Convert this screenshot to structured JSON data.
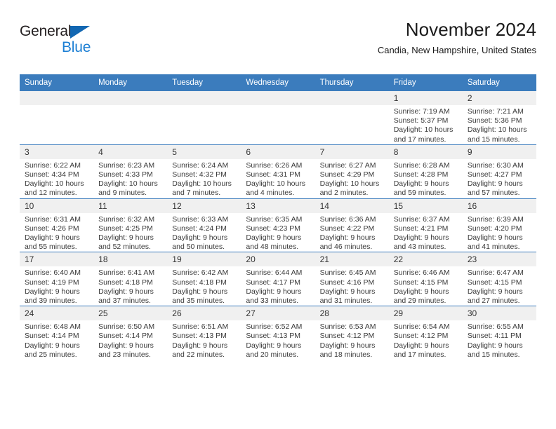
{
  "brand": {
    "name_part1": "General",
    "name_part2": "Blue",
    "triangle_color": "#1267b2",
    "blue_color": "#1c7fd4"
  },
  "header": {
    "month_title": "November 2024",
    "location": "Candia, New Hampshire, United States"
  },
  "theme": {
    "header_blue": "#3b7cbd",
    "daynum_band": "#f0f0f0"
  },
  "calendar": {
    "weekday_headers": [
      "Sunday",
      "Monday",
      "Tuesday",
      "Wednesday",
      "Thursday",
      "Friday",
      "Saturday"
    ],
    "weeks": [
      [
        {
          "day": "",
          "empty": true
        },
        {
          "day": "",
          "empty": true
        },
        {
          "day": "",
          "empty": true
        },
        {
          "day": "",
          "empty": true
        },
        {
          "day": "",
          "empty": true
        },
        {
          "day": "1",
          "sunrise": "Sunrise: 7:19 AM",
          "sunset": "Sunset: 5:37 PM",
          "daylight": "Daylight: 10 hours and 17 minutes."
        },
        {
          "day": "2",
          "sunrise": "Sunrise: 7:21 AM",
          "sunset": "Sunset: 5:36 PM",
          "daylight": "Daylight: 10 hours and 15 minutes."
        }
      ],
      [
        {
          "day": "3",
          "sunrise": "Sunrise: 6:22 AM",
          "sunset": "Sunset: 4:34 PM",
          "daylight": "Daylight: 10 hours and 12 minutes."
        },
        {
          "day": "4",
          "sunrise": "Sunrise: 6:23 AM",
          "sunset": "Sunset: 4:33 PM",
          "daylight": "Daylight: 10 hours and 9 minutes."
        },
        {
          "day": "5",
          "sunrise": "Sunrise: 6:24 AM",
          "sunset": "Sunset: 4:32 PM",
          "daylight": "Daylight: 10 hours and 7 minutes."
        },
        {
          "day": "6",
          "sunrise": "Sunrise: 6:26 AM",
          "sunset": "Sunset: 4:31 PM",
          "daylight": "Daylight: 10 hours and 4 minutes."
        },
        {
          "day": "7",
          "sunrise": "Sunrise: 6:27 AM",
          "sunset": "Sunset: 4:29 PM",
          "daylight": "Daylight: 10 hours and 2 minutes."
        },
        {
          "day": "8",
          "sunrise": "Sunrise: 6:28 AM",
          "sunset": "Sunset: 4:28 PM",
          "daylight": "Daylight: 9 hours and 59 minutes."
        },
        {
          "day": "9",
          "sunrise": "Sunrise: 6:30 AM",
          "sunset": "Sunset: 4:27 PM",
          "daylight": "Daylight: 9 hours and 57 minutes."
        }
      ],
      [
        {
          "day": "10",
          "sunrise": "Sunrise: 6:31 AM",
          "sunset": "Sunset: 4:26 PM",
          "daylight": "Daylight: 9 hours and 55 minutes."
        },
        {
          "day": "11",
          "sunrise": "Sunrise: 6:32 AM",
          "sunset": "Sunset: 4:25 PM",
          "daylight": "Daylight: 9 hours and 52 minutes."
        },
        {
          "day": "12",
          "sunrise": "Sunrise: 6:33 AM",
          "sunset": "Sunset: 4:24 PM",
          "daylight": "Daylight: 9 hours and 50 minutes."
        },
        {
          "day": "13",
          "sunrise": "Sunrise: 6:35 AM",
          "sunset": "Sunset: 4:23 PM",
          "daylight": "Daylight: 9 hours and 48 minutes."
        },
        {
          "day": "14",
          "sunrise": "Sunrise: 6:36 AM",
          "sunset": "Sunset: 4:22 PM",
          "daylight": "Daylight: 9 hours and 46 minutes."
        },
        {
          "day": "15",
          "sunrise": "Sunrise: 6:37 AM",
          "sunset": "Sunset: 4:21 PM",
          "daylight": "Daylight: 9 hours and 43 minutes."
        },
        {
          "day": "16",
          "sunrise": "Sunrise: 6:39 AM",
          "sunset": "Sunset: 4:20 PM",
          "daylight": "Daylight: 9 hours and 41 minutes."
        }
      ],
      [
        {
          "day": "17",
          "sunrise": "Sunrise: 6:40 AM",
          "sunset": "Sunset: 4:19 PM",
          "daylight": "Daylight: 9 hours and 39 minutes."
        },
        {
          "day": "18",
          "sunrise": "Sunrise: 6:41 AM",
          "sunset": "Sunset: 4:18 PM",
          "daylight": "Daylight: 9 hours and 37 minutes."
        },
        {
          "day": "19",
          "sunrise": "Sunrise: 6:42 AM",
          "sunset": "Sunset: 4:18 PM",
          "daylight": "Daylight: 9 hours and 35 minutes."
        },
        {
          "day": "20",
          "sunrise": "Sunrise: 6:44 AM",
          "sunset": "Sunset: 4:17 PM",
          "daylight": "Daylight: 9 hours and 33 minutes."
        },
        {
          "day": "21",
          "sunrise": "Sunrise: 6:45 AM",
          "sunset": "Sunset: 4:16 PM",
          "daylight": "Daylight: 9 hours and 31 minutes."
        },
        {
          "day": "22",
          "sunrise": "Sunrise: 6:46 AM",
          "sunset": "Sunset: 4:15 PM",
          "daylight": "Daylight: 9 hours and 29 minutes."
        },
        {
          "day": "23",
          "sunrise": "Sunrise: 6:47 AM",
          "sunset": "Sunset: 4:15 PM",
          "daylight": "Daylight: 9 hours and 27 minutes."
        }
      ],
      [
        {
          "day": "24",
          "sunrise": "Sunrise: 6:48 AM",
          "sunset": "Sunset: 4:14 PM",
          "daylight": "Daylight: 9 hours and 25 minutes."
        },
        {
          "day": "25",
          "sunrise": "Sunrise: 6:50 AM",
          "sunset": "Sunset: 4:14 PM",
          "daylight": "Daylight: 9 hours and 23 minutes."
        },
        {
          "day": "26",
          "sunrise": "Sunrise: 6:51 AM",
          "sunset": "Sunset: 4:13 PM",
          "daylight": "Daylight: 9 hours and 22 minutes."
        },
        {
          "day": "27",
          "sunrise": "Sunrise: 6:52 AM",
          "sunset": "Sunset: 4:13 PM",
          "daylight": "Daylight: 9 hours and 20 minutes."
        },
        {
          "day": "28",
          "sunrise": "Sunrise: 6:53 AM",
          "sunset": "Sunset: 4:12 PM",
          "daylight": "Daylight: 9 hours and 18 minutes."
        },
        {
          "day": "29",
          "sunrise": "Sunrise: 6:54 AM",
          "sunset": "Sunset: 4:12 PM",
          "daylight": "Daylight: 9 hours and 17 minutes."
        },
        {
          "day": "30",
          "sunrise": "Sunrise: 6:55 AM",
          "sunset": "Sunset: 4:11 PM",
          "daylight": "Daylight: 9 hours and 15 minutes."
        }
      ]
    ]
  }
}
